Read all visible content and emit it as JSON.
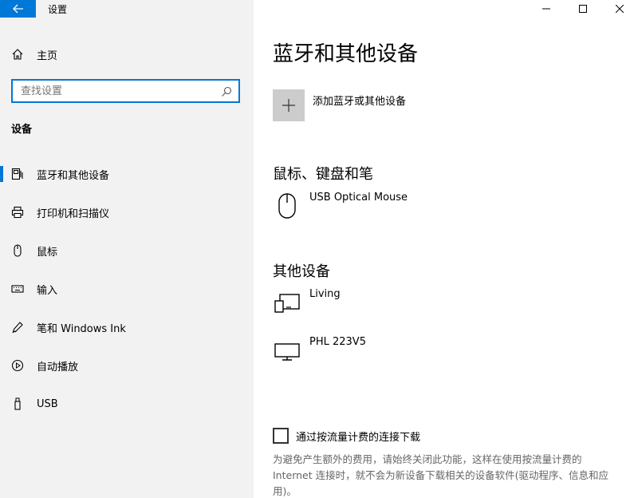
{
  "app": {
    "title": "设置"
  },
  "sidebar": {
    "home_label": "主页",
    "search_placeholder": "查找设置",
    "section_heading": "设备",
    "items": [
      {
        "label": "蓝牙和其他设备",
        "icon": "bluetooth-devices-icon",
        "active": true
      },
      {
        "label": "打印机和扫描仪",
        "icon": "printer-icon",
        "active": false
      },
      {
        "label": "鼠标",
        "icon": "mouse-icon",
        "active": false
      },
      {
        "label": "输入",
        "icon": "keyboard-icon",
        "active": false
      },
      {
        "label": "笔和 Windows Ink",
        "icon": "pen-icon",
        "active": false
      },
      {
        "label": "自动播放",
        "icon": "autoplay-icon",
        "active": false
      },
      {
        "label": "USB",
        "icon": "usb-icon",
        "active": false
      }
    ]
  },
  "main": {
    "title": "蓝牙和其他设备",
    "add_device_label": "添加蓝牙或其他设备",
    "groups": [
      {
        "title": "鼠标、键盘和笔",
        "devices": [
          {
            "name": "USB Optical Mouse",
            "icon": "mouse-icon"
          }
        ]
      },
      {
        "title": "其他设备",
        "devices": [
          {
            "name": "Living",
            "icon": "media-device-icon"
          },
          {
            "name": "PHL 223V5",
            "icon": "monitor-icon"
          }
        ]
      }
    ],
    "metered_label": "通过按流量计费的连接下载",
    "metered_checked": false,
    "metered_description": "为避免产生额外的费用，请始终关闭此功能，这样在使用按流量计费的 Internet 连接时，就不会为新设备下载相关的设备软件(驱动程序、信息和应用)。"
  },
  "colors": {
    "accent": "#0078d7",
    "sidebar_bg": "#f2f2f2",
    "add_tile_bg": "#cccccc"
  }
}
